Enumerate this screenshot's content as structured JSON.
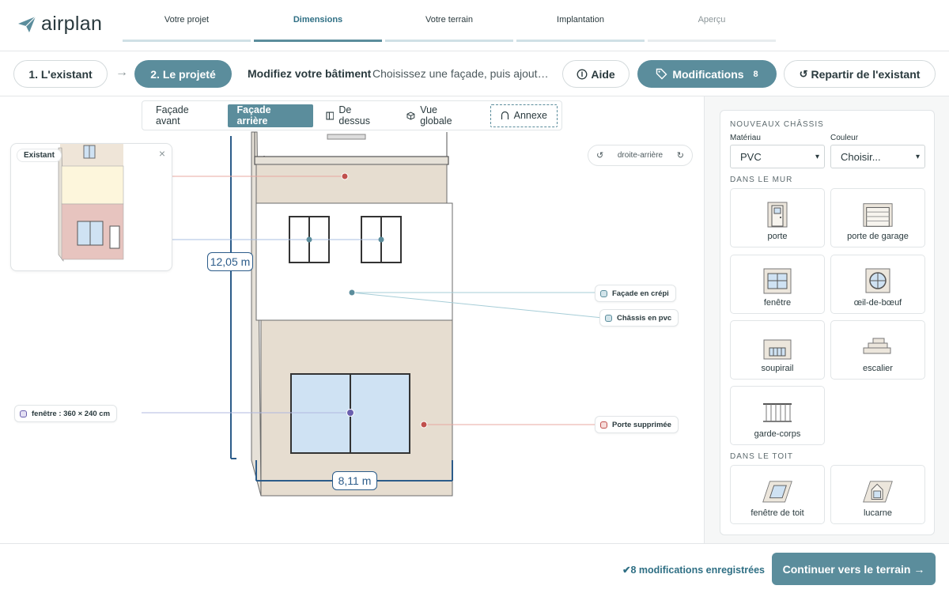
{
  "app": {
    "logo": "airplan"
  },
  "steps": [
    {
      "label": "Votre projet"
    },
    {
      "label": "Dimensions"
    },
    {
      "label": "Votre terrain"
    },
    {
      "label": "Implantation"
    },
    {
      "label": "Aperçu"
    }
  ],
  "toolbar": {
    "existing_label": "1. L'existant",
    "project_label": "2. Le projeté",
    "instr_title": "Modifiez votre bâtiment",
    "instr_text": "Choisissez une façade, puis ajoutez les éléments",
    "help_label": "Aide",
    "modifications_label": "Modifications",
    "modifications_count": "8",
    "reset_label": "Repartir de l'existant"
  },
  "view_tabs": [
    {
      "label": "Façade avant"
    },
    {
      "label": "Façade arrière"
    },
    {
      "label": "De dessus"
    },
    {
      "label": "Vue globale"
    },
    {
      "label": "Annexe"
    }
  ],
  "existant_card": {
    "label": "Existant",
    "close": "×"
  },
  "orientation": {
    "label": "droite-arrière"
  },
  "dimensions": {
    "height": "12,05 m",
    "width": "8,11 m"
  },
  "annotations": {
    "facade": "Façade en crépi",
    "chassis": "Châssis en pvc",
    "window": "fenêtre : 360 × 240 cm",
    "door": "Porte supprimée"
  },
  "sidebar": {
    "section_new": "NOUVEAUX CHÂSSIS",
    "material_label": "Matériau",
    "material_value": "PVC",
    "color_label": "Couleur",
    "color_value": "Choisir...",
    "section_wall": "DANS LE MUR",
    "section_roof": "DANS LE TOIT",
    "wall_items": [
      {
        "label": "porte",
        "icon": "door-icon"
      },
      {
        "label": "porte de garage",
        "icon": "garage-door-icon"
      },
      {
        "label": "fenêtre",
        "icon": "window-icon"
      },
      {
        "label": "œil-de-bœuf",
        "icon": "round-window-icon"
      },
      {
        "label": "soupirail",
        "icon": "basement-window-icon"
      },
      {
        "label": "escalier",
        "icon": "stairs-icon"
      },
      {
        "label": "garde-corps",
        "icon": "railing-icon"
      }
    ],
    "roof_items": [
      {
        "label": "fenêtre de toit",
        "icon": "roof-window-icon"
      },
      {
        "label": "lucarne",
        "icon": "dormer-icon"
      }
    ]
  },
  "footer": {
    "saved_text": "✔8 modifications enregistrées",
    "continue_label": "Continuer vers le terrain →"
  },
  "colors": {
    "accent": "#5b8d9c",
    "dimension": "#2c5c8a",
    "removed": "#c0504d"
  }
}
